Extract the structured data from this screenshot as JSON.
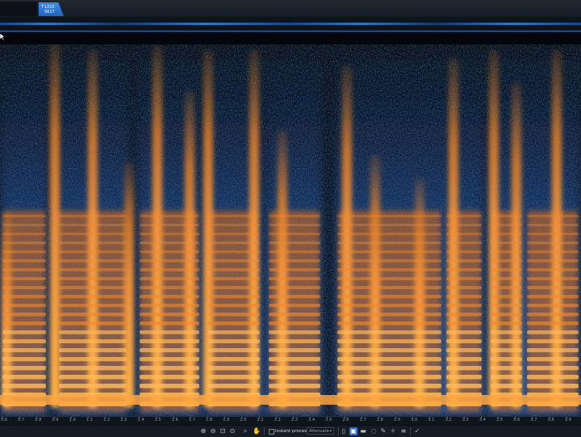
{
  "tabs": [
    {
      "glyph": "↑",
      "line1": "1215",
      "line2": "5617"
    }
  ],
  "ruler": {
    "ticks": [
      "0.6",
      "0.7",
      "0.8",
      "0.9",
      "1.0",
      "1.1",
      "1.2",
      "1.3",
      "1.4",
      "1.5",
      "1.6",
      "1.7",
      "1.8",
      "1.9",
      "2.0",
      "2.1",
      "2.2",
      "2.3",
      "2.4",
      "2.5",
      "2.6",
      "2.7",
      "2.8",
      "2.9",
      "3.0",
      "3.1",
      "3.2",
      "3.3",
      "3.4",
      "3.5",
      "3.6",
      "3.7",
      "3.8",
      "3.9"
    ]
  },
  "toolbar": {
    "instant_process_label": "Instant process",
    "instant_process_mode": "Attenuate",
    "icons": [
      "zoom-in-icon",
      "zoom-out-icon",
      "zoom-selection-icon",
      "zoom-fit-icon",
      "zoom-icon",
      "hand-icon"
    ],
    "tool_icons": [
      "time-select-icon",
      "rect-select-icon",
      "freq-select-icon",
      "lasso-icon",
      "brush-icon",
      "magic-wand-icon",
      "harmonic-select-icon",
      "settings-icon"
    ]
  },
  "colors": {
    "accent": "#2d6fd1",
    "spectrogram_hot": "#ffb347",
    "spectrogram_mid": "#e07a1f",
    "spectrogram_cool": "#1a3f80",
    "background": "#03060c"
  }
}
